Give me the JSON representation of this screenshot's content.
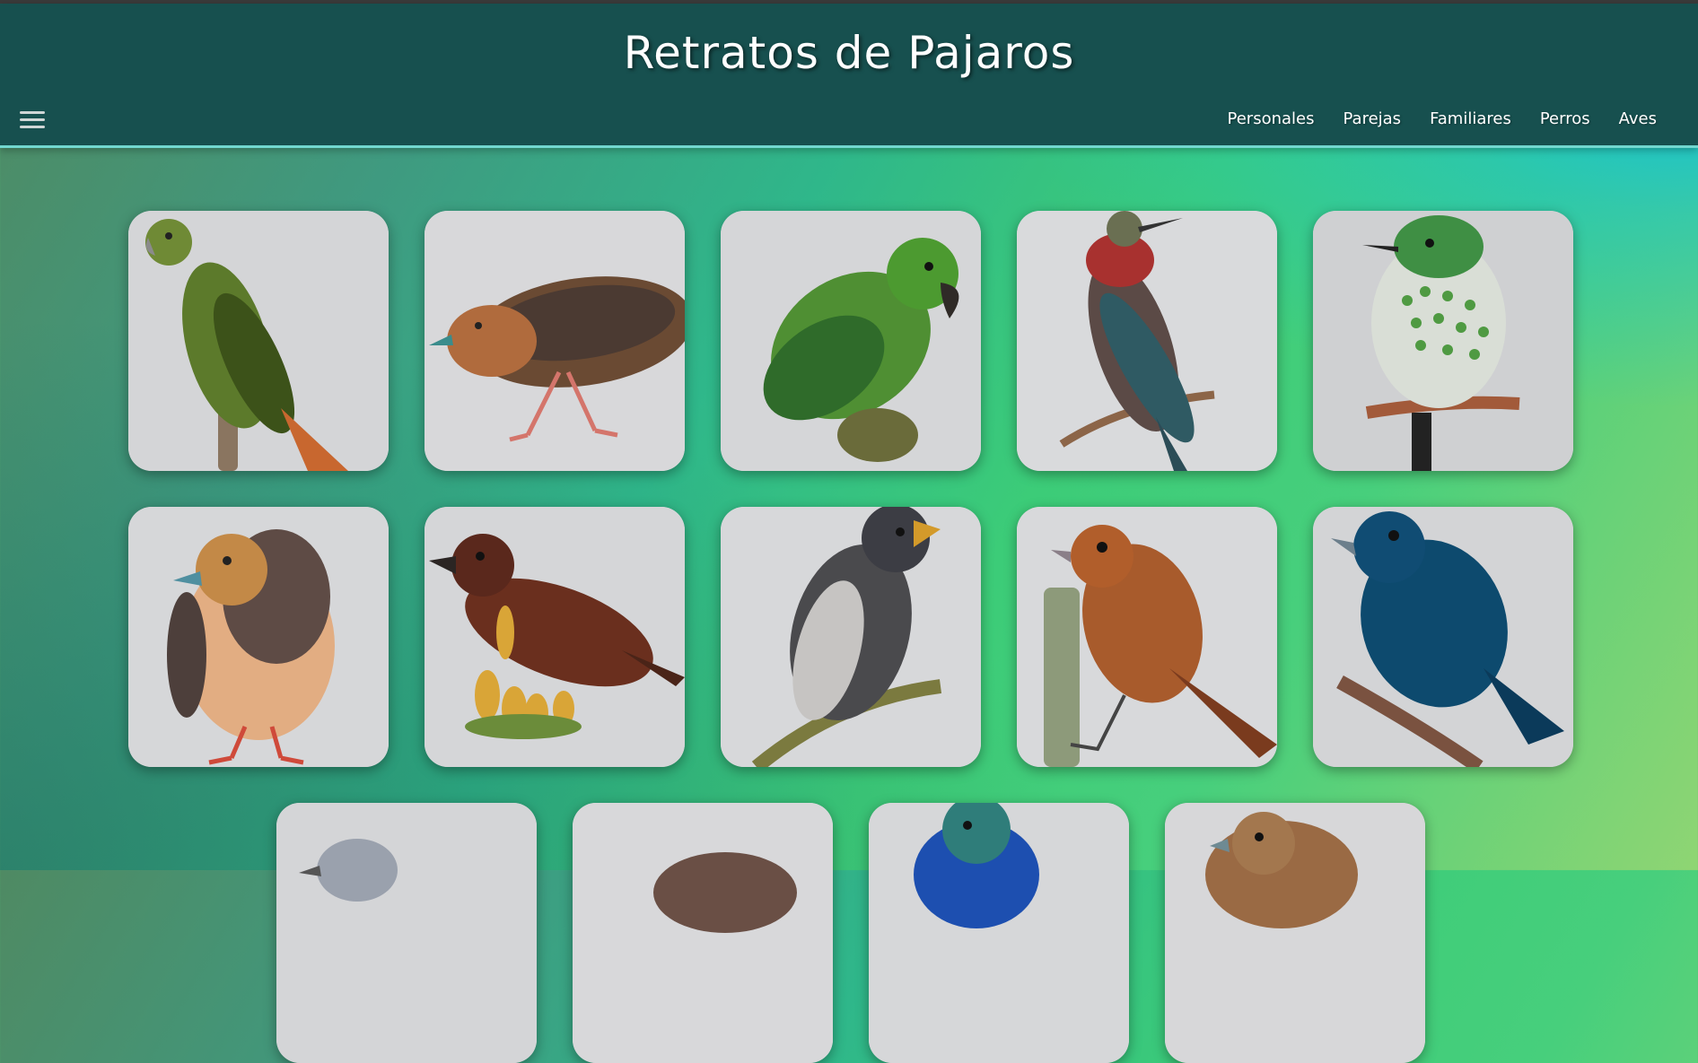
{
  "header": {
    "title": "Retratos de Pajaros",
    "menu_icon": "hamburger-menu-icon",
    "nav": [
      {
        "label": "Personales"
      },
      {
        "label": "Parejas"
      },
      {
        "label": "Familiares"
      },
      {
        "label": "Perros"
      },
      {
        "label": "Aves"
      }
    ]
  },
  "colors": {
    "header_bg": "#17504f",
    "header_border": "#72d7cf",
    "gallery_gradient_start": "#4f8a63",
    "gallery_gradient_mid": "#3ccc78",
    "gallery_gradient_end": "#8fd573",
    "corner_accent": "#19c3d0"
  },
  "gallery": {
    "items": [
      {
        "subject": "green parrot on branch"
      },
      {
        "subject": "spotted brown crake"
      },
      {
        "subject": "green parakeet"
      },
      {
        "subject": "red-throated hummingbird"
      },
      {
        "subject": "spotted green hummingbird"
      },
      {
        "subject": "orange-breasted crake"
      },
      {
        "subject": "brown seedeater on flowers"
      },
      {
        "subject": "gray grosbeak on branch"
      },
      {
        "subject": "rufous bird on post"
      },
      {
        "subject": "blue grassquit on branch"
      },
      {
        "subject": "gray bird"
      },
      {
        "subject": "brown bird"
      },
      {
        "subject": "blue and white bird"
      },
      {
        "subject": "brown finch"
      }
    ]
  }
}
